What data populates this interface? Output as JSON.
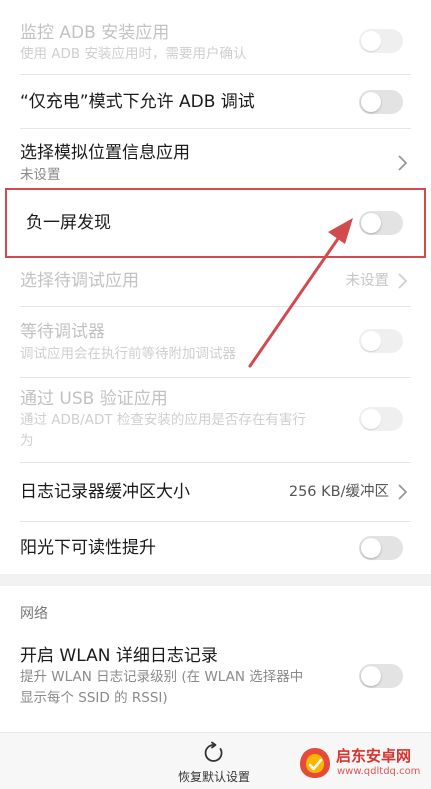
{
  "settings": {
    "monitor_adb": {
      "title": "监控 ADB 安装应用",
      "subtitle": "使用 ADB 安装应用时，需要用户确认",
      "toggle_on": false,
      "enabled": false
    },
    "charge_only_adb": {
      "title": "“仅充电”模式下允许 ADB 调试",
      "toggle_on": false,
      "enabled": true
    },
    "mock_location": {
      "title": "选择模拟位置信息应用",
      "subtitle": "未设置",
      "enabled": true
    },
    "minus_one_screen": {
      "title": "负一屏发现",
      "toggle_on": false,
      "enabled": true
    },
    "debug_app": {
      "title": "选择待调试应用",
      "value": "未设置",
      "enabled": false
    },
    "wait_debugger": {
      "title": "等待调试器",
      "subtitle": "调试应用会在执行前等待附加调试器",
      "toggle_on": false,
      "enabled": false
    },
    "verify_usb": {
      "title": "通过 USB 验证应用",
      "subtitle_line1": "通过 ADB/ADT 检查安装的应用是否存在有害行",
      "subtitle_line2": "为",
      "toggle_on": false,
      "enabled": false
    },
    "logger_buffer": {
      "title": "日志记录器缓冲区大小",
      "value": "256 KB/缓冲区",
      "enabled": true
    },
    "sunlight": {
      "title": "阳光下可读性提升",
      "toggle_on": false,
      "enabled": true
    }
  },
  "network": {
    "section_title": "网络",
    "wlan_verbose": {
      "title": "开启 WLAN 详细日志记录",
      "subtitle_line1": "提升 WLAN 日志记录级别 (在 WLAN 选择器中",
      "subtitle_line2": "显示每个 SSID 的 RSSI)",
      "toggle_on": false,
      "enabled": true
    }
  },
  "bottom": {
    "restore_label": "恢复默认设置"
  },
  "watermark": {
    "name": "启东安卓网",
    "url": "www.qdltdq.com"
  },
  "colors": {
    "highlight": "#d14a4e",
    "watermark": "#d8332e"
  }
}
